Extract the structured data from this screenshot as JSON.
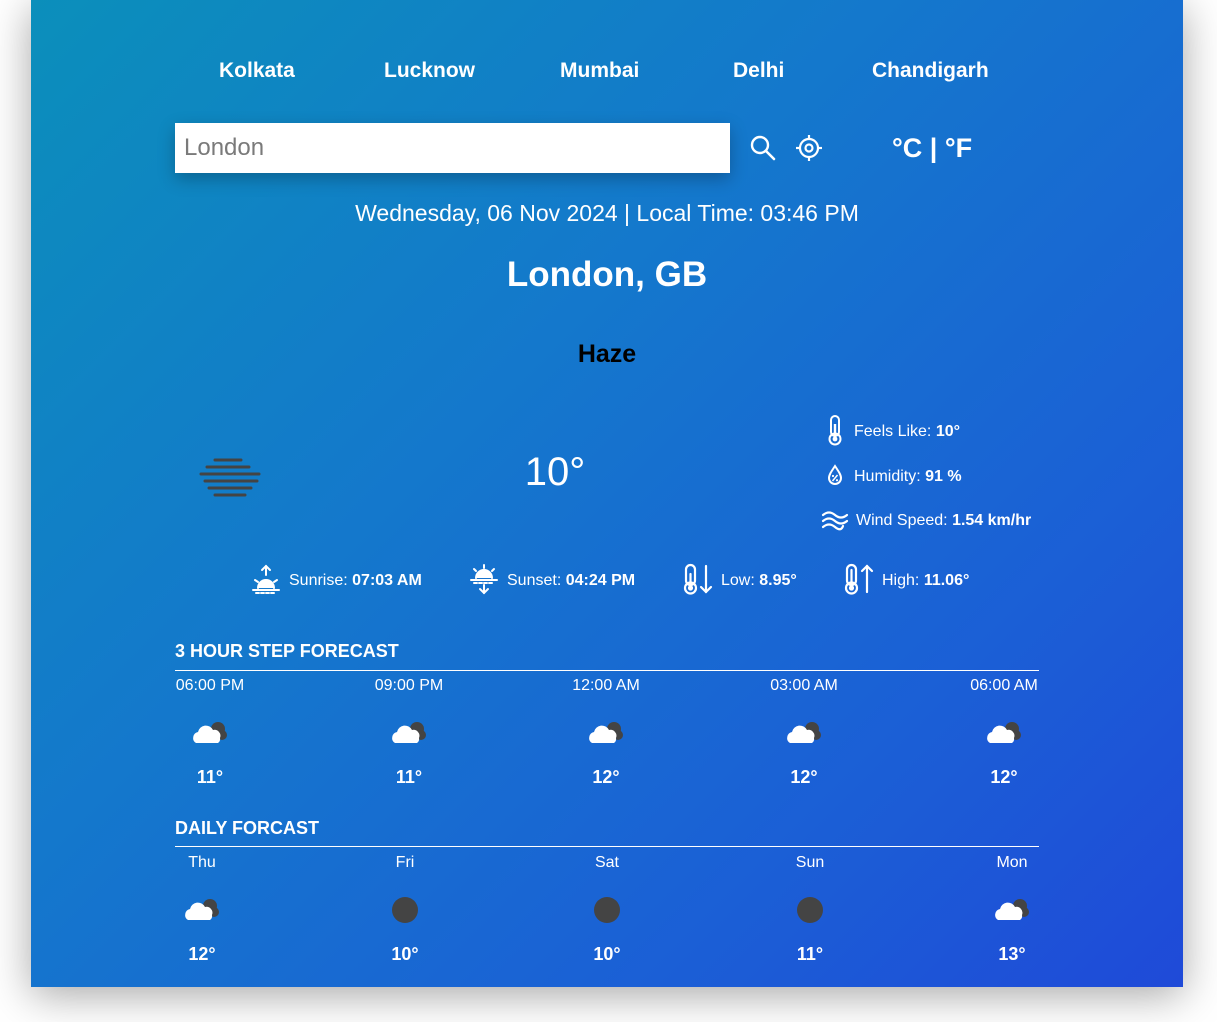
{
  "cities": [
    "Kolkata",
    "Lucknow",
    "Mumbai",
    "Delhi",
    "Chandigarh"
  ],
  "search": {
    "value": "",
    "placeholder": "London"
  },
  "units_label": "°C | °F",
  "datetime": "Wednesday, 06 Nov 2024 | Local Time: 03:46 PM",
  "location": "London, GB",
  "condition": "Haze",
  "temperature": "10°",
  "icons": {
    "search": "search-icon",
    "locate": "location-crosshair-icon",
    "haze": "haze-icon",
    "feels": "thermometer-icon",
    "humidity": "humidity-drop-icon",
    "wind": "wind-icon",
    "sunrise": "sunrise-icon",
    "sunset": "sunset-icon",
    "low": "low-temp-icon",
    "high": "high-temp-icon",
    "cloud": "cloud-icon",
    "moon": "dark-circle-icon"
  },
  "details": {
    "feels_label": "Feels Like:",
    "feels_value": "10°",
    "humidity_label": "Humidity:",
    "humidity_value": "91 %",
    "wind_label": "Wind Speed:",
    "wind_value": "1.54 km/hr"
  },
  "sun": {
    "sunrise_label": "Sunrise:",
    "sunrise_value": "07:03 AM",
    "sunset_label": "Sunset:",
    "sunset_value": "04:24 PM",
    "low_label": "Low:",
    "low_value": "8.95°",
    "high_label": "High:",
    "high_value": "11.06°"
  },
  "hourly": {
    "title": "3 HOUR STEP FORECAST",
    "items": [
      {
        "label": "06:00 PM",
        "temp": "11°",
        "icon": "cloud"
      },
      {
        "label": "09:00 PM",
        "temp": "11°",
        "icon": "cloud"
      },
      {
        "label": "12:00 AM",
        "temp": "12°",
        "icon": "cloud"
      },
      {
        "label": "03:00 AM",
        "temp": "12°",
        "icon": "cloud"
      },
      {
        "label": "06:00 AM",
        "temp": "12°",
        "icon": "cloud"
      }
    ]
  },
  "daily": {
    "title": "DAILY FORCAST",
    "items": [
      {
        "label": "Thu",
        "temp": "12°",
        "icon": "cloud"
      },
      {
        "label": "Fri",
        "temp": "10°",
        "icon": "moon"
      },
      {
        "label": "Sat",
        "temp": "10°",
        "icon": "moon"
      },
      {
        "label": "Sun",
        "temp": "11°",
        "icon": "moon"
      },
      {
        "label": "Mon",
        "temp": "13°",
        "icon": "cloud"
      }
    ]
  },
  "colors": {
    "gradient_start": "#0b8fbb",
    "gradient_end": "#1f4ad8",
    "condition_text": "#000000",
    "icon_dark": "#444444"
  }
}
